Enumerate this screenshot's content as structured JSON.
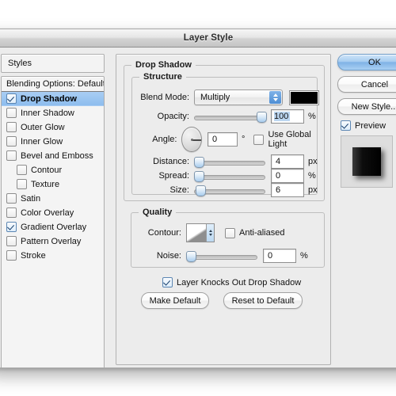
{
  "window": {
    "title": "Layer Style"
  },
  "sidebar": {
    "styles_label": "Styles",
    "items": [
      {
        "label": "Blending Options: Default",
        "checked": false,
        "hasCheckbox": false,
        "selected": false,
        "sub": false
      },
      {
        "label": "Drop Shadow",
        "checked": true,
        "hasCheckbox": true,
        "selected": true,
        "sub": false
      },
      {
        "label": "Inner Shadow",
        "checked": false,
        "hasCheckbox": true,
        "selected": false,
        "sub": false
      },
      {
        "label": "Outer Glow",
        "checked": false,
        "hasCheckbox": true,
        "selected": false,
        "sub": false
      },
      {
        "label": "Inner Glow",
        "checked": false,
        "hasCheckbox": true,
        "selected": false,
        "sub": false
      },
      {
        "label": "Bevel and Emboss",
        "checked": false,
        "hasCheckbox": true,
        "selected": false,
        "sub": false
      },
      {
        "label": "Contour",
        "checked": false,
        "hasCheckbox": true,
        "selected": false,
        "sub": true
      },
      {
        "label": "Texture",
        "checked": false,
        "hasCheckbox": true,
        "selected": false,
        "sub": true
      },
      {
        "label": "Satin",
        "checked": false,
        "hasCheckbox": true,
        "selected": false,
        "sub": false
      },
      {
        "label": "Color Overlay",
        "checked": false,
        "hasCheckbox": true,
        "selected": false,
        "sub": false
      },
      {
        "label": "Gradient Overlay",
        "checked": true,
        "hasCheckbox": true,
        "selected": false,
        "sub": false
      },
      {
        "label": "Pattern Overlay",
        "checked": false,
        "hasCheckbox": true,
        "selected": false,
        "sub": false
      },
      {
        "label": "Stroke",
        "checked": false,
        "hasCheckbox": true,
        "selected": false,
        "sub": false
      }
    ]
  },
  "panel": {
    "title": "Drop Shadow",
    "structure": {
      "legend": "Structure",
      "blend_mode_label": "Blend Mode:",
      "blend_mode_value": "Multiply",
      "shadow_color": "#000000",
      "opacity_label": "Opacity:",
      "opacity_value": "100",
      "opacity_unit": "%",
      "angle_label": "Angle:",
      "angle_value": "0",
      "angle_unit": "°",
      "use_global_light_label": "Use Global Light",
      "use_global_light_checked": false,
      "distance_label": "Distance:",
      "distance_value": "4",
      "distance_unit": "px",
      "spread_label": "Spread:",
      "spread_value": "0",
      "spread_unit": "%",
      "size_label": "Size:",
      "size_value": "6",
      "size_unit": "px"
    },
    "quality": {
      "legend": "Quality",
      "contour_label": "Contour:",
      "anti_aliased_label": "Anti-aliased",
      "anti_aliased_checked": false,
      "noise_label": "Noise:",
      "noise_value": "0",
      "noise_unit": "%"
    },
    "knockout_label": "Layer Knocks Out Drop Shadow",
    "knockout_checked": true,
    "make_default_label": "Make Default",
    "reset_default_label": "Reset to Default"
  },
  "actions": {
    "ok_label": "OK",
    "cancel_label": "Cancel",
    "new_style_label": "New Style...",
    "preview_label": "Preview",
    "preview_checked": true
  },
  "colors": {
    "accent": "#8dbdee",
    "dialog_bg": "#ececec",
    "title_text": "#2d2d2d"
  }
}
